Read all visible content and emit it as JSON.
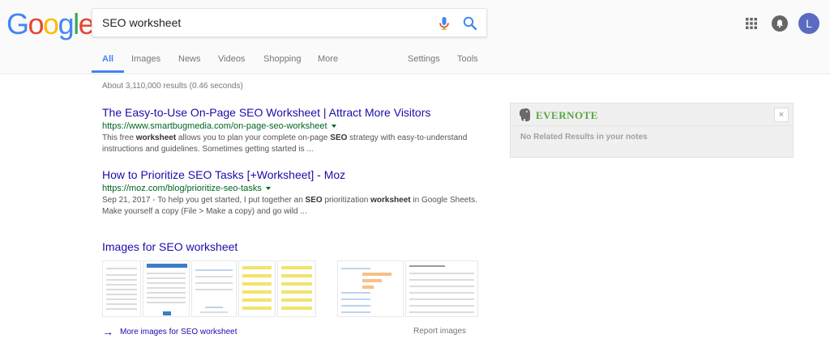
{
  "logo": [
    "G",
    "o",
    "o",
    "g",
    "l",
    "e"
  ],
  "colors": {
    "blue": "#4285f4",
    "red": "#ea4335",
    "yellow": "#fbbc05",
    "green": "#34a853",
    "link": "#1a0dab",
    "url": "#006621",
    "evernote": "#59a744"
  },
  "search": {
    "query": "SEO worksheet",
    "mic_icon": "mic-icon",
    "search_icon": "search-icon"
  },
  "header": {
    "apps_icon": "apps-grid-icon",
    "notifications_icon": "notifications-icon",
    "avatar_letter": "L"
  },
  "tabs": [
    "All",
    "Images",
    "News",
    "Videos",
    "Shopping",
    "More",
    "Settings",
    "Tools"
  ],
  "stats": "About 3,110,000 results (0.46 seconds)",
  "results": [
    {
      "title": "The Easy-to-Use On-Page SEO Worksheet | Attract More Visitors",
      "url": "https://www.smartbugmedia.com/on-page-seo-worksheet",
      "snippet_parts": [
        "This free ",
        "worksheet",
        " allows you to plan your complete on-page ",
        "SEO",
        " strategy with easy-to-understand instructions and guidelines. Sometimes getting started is ..."
      ]
    },
    {
      "title": "How to Prioritize SEO Tasks [+Worksheet] - Moz",
      "url": "https://moz.com/blog/prioritize-seo-tasks",
      "snippet_parts": [
        "Sep 21, 2017 - To help you get started, I put together an ",
        "SEO",
        " prioritization ",
        "worksheet",
        " in Google Sheets. Make yourself a copy (File > Make a copy) and go wild ..."
      ]
    }
  ],
  "images": {
    "title": "Images for SEO worksheet",
    "more_label": "More images for SEO worksheet",
    "report_label": "Report images"
  },
  "evernote": {
    "name": "EVERNOTE",
    "close_label": "×",
    "message": "No Related Results in your notes"
  }
}
